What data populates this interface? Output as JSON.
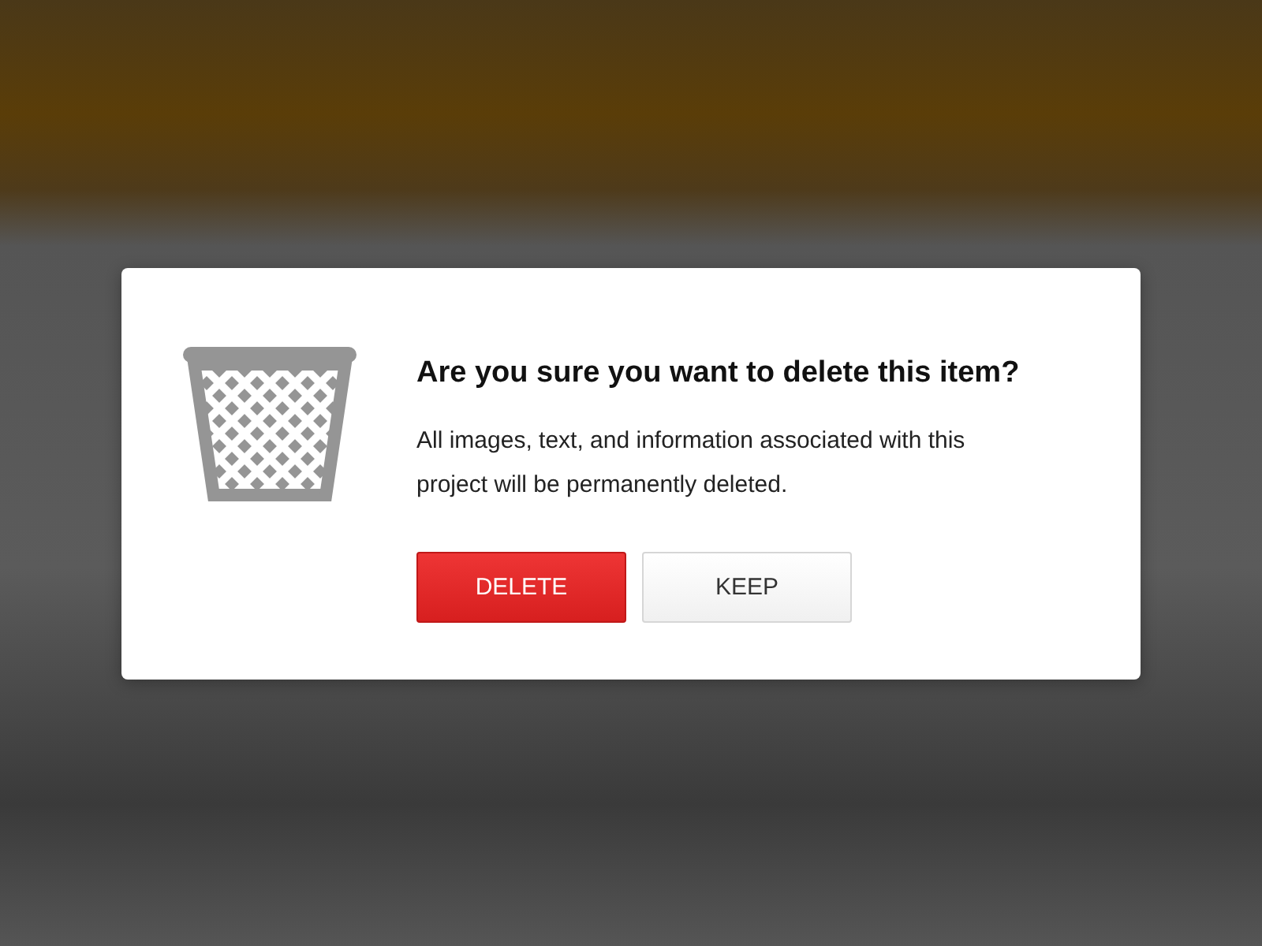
{
  "dialog": {
    "title": "Are you sure you want to delete this item?",
    "message": "All images, text, and information associated with this project will be permanently deleted.",
    "buttons": [
      {
        "label": "DELETE",
        "kind": "danger"
      },
      {
        "label": "KEEP",
        "kind": "default"
      }
    ]
  }
}
